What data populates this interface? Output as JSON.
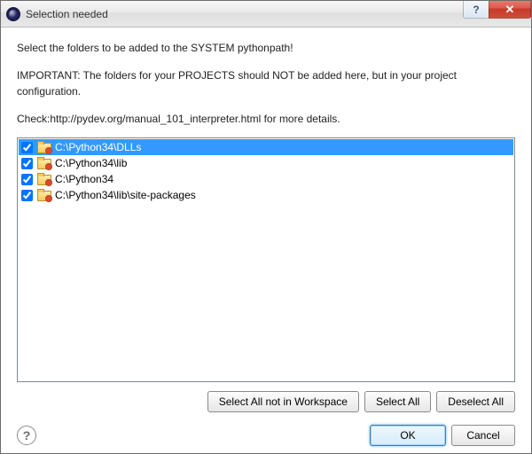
{
  "window": {
    "title": "Selection needed"
  },
  "intro": {
    "line1": "Select the folders to be added to the SYSTEM pythonpath!",
    "line2": "IMPORTANT: The folders for your PROJECTS should NOT be added here, but in your project configuration.",
    "line3": "Check:http://pydev.org/manual_101_interpreter.html for more details."
  },
  "list": {
    "items": [
      {
        "checked": true,
        "selected": true,
        "path": "C:\\Python34\\DLLs"
      },
      {
        "checked": true,
        "selected": false,
        "path": "C:\\Python34\\lib"
      },
      {
        "checked": true,
        "selected": false,
        "path": "C:\\Python34"
      },
      {
        "checked": true,
        "selected": false,
        "path": "C:\\Python34\\lib\\site-packages"
      }
    ]
  },
  "buttons": {
    "select_all_not_in_workspace": "Select All not in Workspace",
    "select_all": "Select All",
    "deselect_all": "Deselect All",
    "ok": "OK",
    "cancel": "Cancel"
  },
  "win_controls": {
    "help_glyph": "?",
    "close_glyph": "✕"
  },
  "help_icon_glyph": "?"
}
